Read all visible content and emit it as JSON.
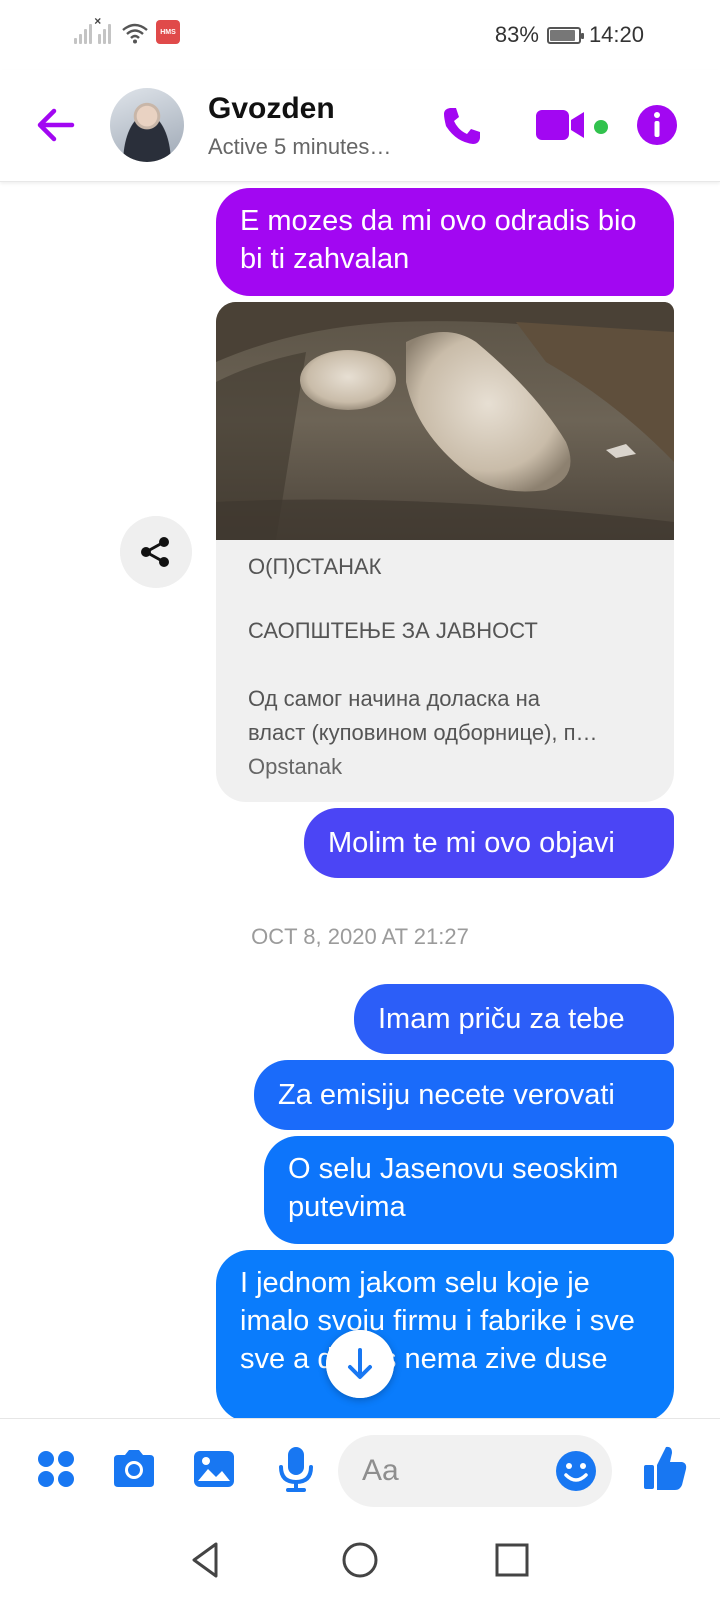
{
  "status_bar": {
    "battery_percent": "83%",
    "time": "14:20",
    "hms_badge": "HMS",
    "icons": [
      "signal-icon",
      "signal-no-sim-icon",
      "wifi-icon",
      "hms-badge-icon",
      "battery-icon"
    ]
  },
  "header": {
    "contact_name": "Gvozden",
    "presence": "Active 5 minutes…",
    "accent_color": "#a207f2",
    "online_color": "#31c24d",
    "icons": [
      "back-arrow-icon",
      "phone-icon",
      "video-camera-icon",
      "info-icon"
    ]
  },
  "messages": {
    "m1": "E mozes da mi ovo odradis bio bi ti zahvalan",
    "link_card": {
      "title": "О(П)СТАНАК",
      "subtitle": "САОПШТЕЊЕ ЗА ЈАВНОСТ",
      "excerpt_line1": " Од самог начина доласка на",
      "excerpt_line2": "власт (куповином одборнице),  п…",
      "source": "Opstanak"
    },
    "m2": "Molim te mi ovo objavi",
    "timestamp": "OCT 8, 2020 AT 21:27",
    "m3": "Imam priču za tebe",
    "m4": "Za emisiju necete verovati",
    "m5": "O selu Jasenovu seoskim putevima",
    "m6": "I jednom jakom selu koje je imalo svoju firmu i fabrike i sve sve a danas nema zive duse"
  },
  "composer": {
    "placeholder": "Aa",
    "icons": [
      "menu-dots-icon",
      "camera-icon",
      "gallery-icon",
      "microphone-icon",
      "emoji-icon",
      "thumbs-up-icon"
    ]
  },
  "navbar": {
    "icons": [
      "nav-back-icon",
      "nav-home-icon",
      "nav-recents-icon"
    ]
  },
  "colors": {
    "bubble_gradient": [
      "#a207f2",
      "#4b45f5",
      "#2c5ef8",
      "#1a6bfa",
      "#0d75fb",
      "#0a7cfc"
    ],
    "composer_accent": "#1877f2"
  }
}
